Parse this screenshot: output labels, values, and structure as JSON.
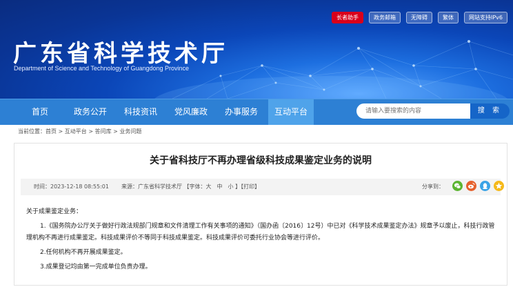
{
  "header": {
    "title_cn": "广东省科学技术厅",
    "title_en": "Department of Science and Technology of Guangdong Province",
    "top_links": [
      "长者助手",
      "政务邮箱",
      "无障碍",
      "繁体",
      "网站支持IPv6"
    ]
  },
  "nav": {
    "items": [
      "首页",
      "政务公开",
      "科技资讯",
      "党风廉政",
      "办事服务",
      "互动平台"
    ],
    "active_index": 5
  },
  "search": {
    "placeholder": "请输入要搜索的内容",
    "button": "搜 索"
  },
  "breadcrumb": "当前位置：首页 > 互动平台 > 答问库 > 业务问题",
  "article": {
    "title": "关于省科技厅不再办理省级科技成果鉴定业务的说明",
    "time": "时间：2023-12-18 08:55:01",
    "source": "来源：广东省科学技术厅 【字体：大　中　小 】【打印】",
    "share_label": "分享到：",
    "share_icons": [
      "wechat-icon",
      "weibo-icon",
      "qq-icon",
      "qzone-icon"
    ],
    "paragraphs": [
      "关于成果鉴定业务：",
      "1.《国务院办公厅关于做好行政法规部门规章和文件清理工作有关事项的通知》（国办函〔2016〕12号）中已对《科学技术成果鉴定办法》规章予以废止，科技行政管理机构不再进行成果鉴定。科技成果评价不等同于科技成果鉴定。科技成果评价可委托行业协会等进行评价。",
      "2.任何机构不再开展成果鉴定。",
      "3.成果登记均由第一完成单位负责办理。"
    ]
  },
  "colors": {
    "nav_bg": "#2d80d4",
    "nav_active": "#4fa3ea",
    "search_button": "#1565c8",
    "elder_badge": "#d9001b",
    "share_wechat": "#5cb531",
    "share_weibo": "#e6612c",
    "share_qq": "#3aa3e6",
    "share_qzone": "#f5b91a"
  }
}
